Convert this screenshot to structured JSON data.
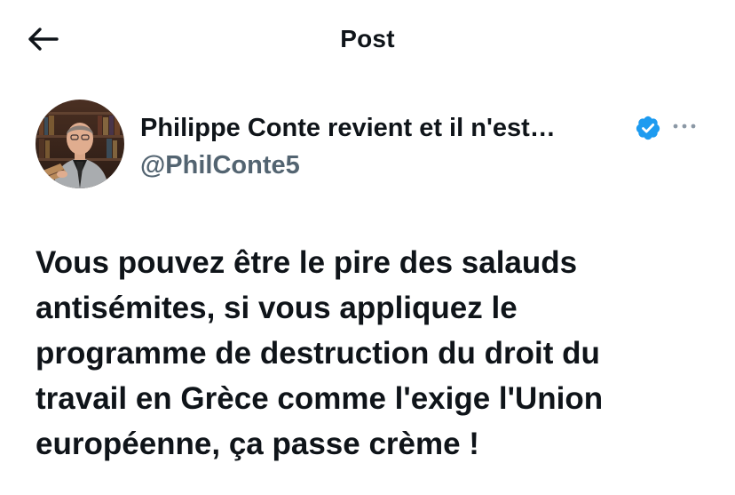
{
  "header": {
    "title": "Post",
    "back_icon": "arrow-left-icon"
  },
  "author": {
    "display_name": "Philippe Conte revient et il n'est…",
    "handle": "@PhilConte5",
    "verified_icon": "verified-badge-icon",
    "verified_color": "#1d9bf0",
    "more_icon": "more-horizontal-icon"
  },
  "post": {
    "text": "Vous pouvez être le pire des salauds\nantisémites, si vous appliquez le\nprogramme de destruction du droit du\ntravail en Grèce comme l'exige l'Union\neuropéenne, ça passe crème !"
  },
  "colors": {
    "text_primary": "#0f1419",
    "text_secondary": "#536471",
    "accent": "#1d9bf0"
  }
}
